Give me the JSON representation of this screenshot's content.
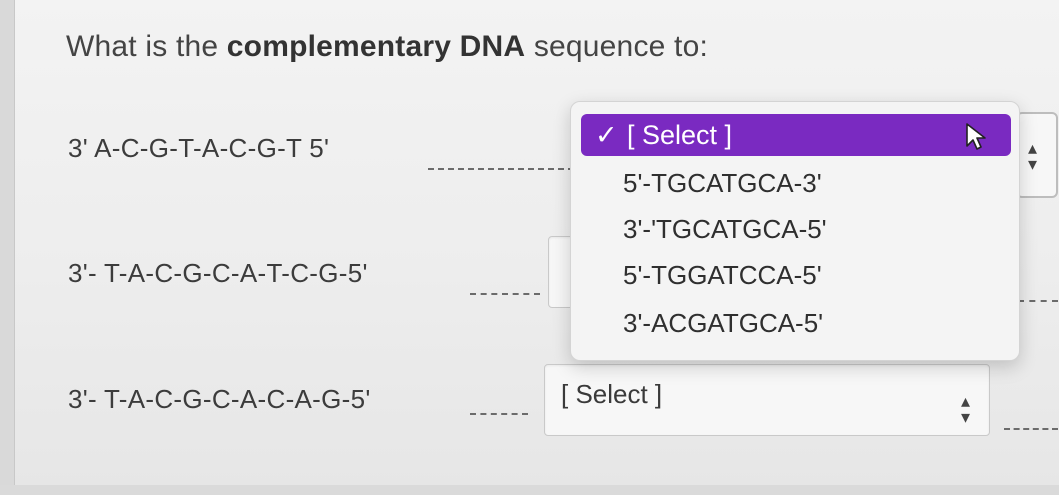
{
  "question": {
    "prefix": "What is the ",
    "bold": "complementary DNA",
    "suffix": " sequence to:"
  },
  "rows": [
    {
      "sequence": "3' A-C-G-T-A-C-G-T 5'"
    },
    {
      "sequence": "3'- T-A-C-G-C-A-T-C-G-5'"
    },
    {
      "sequence": "3'- T-A-C-G-C-A-C-A-G-5'"
    }
  ],
  "dropdown": {
    "selected_label": "[ Select ]",
    "check_icon": "✓",
    "options": [
      "5'-TGCATGCA-3'",
      "3'-'TGCATGCA-5'",
      "5'-TGGATCCA-5'",
      "3'-ACGATGCA-5'"
    ]
  },
  "select3": {
    "value": "[ Select ]"
  },
  "colors": {
    "highlight": "#7a2ac1"
  }
}
